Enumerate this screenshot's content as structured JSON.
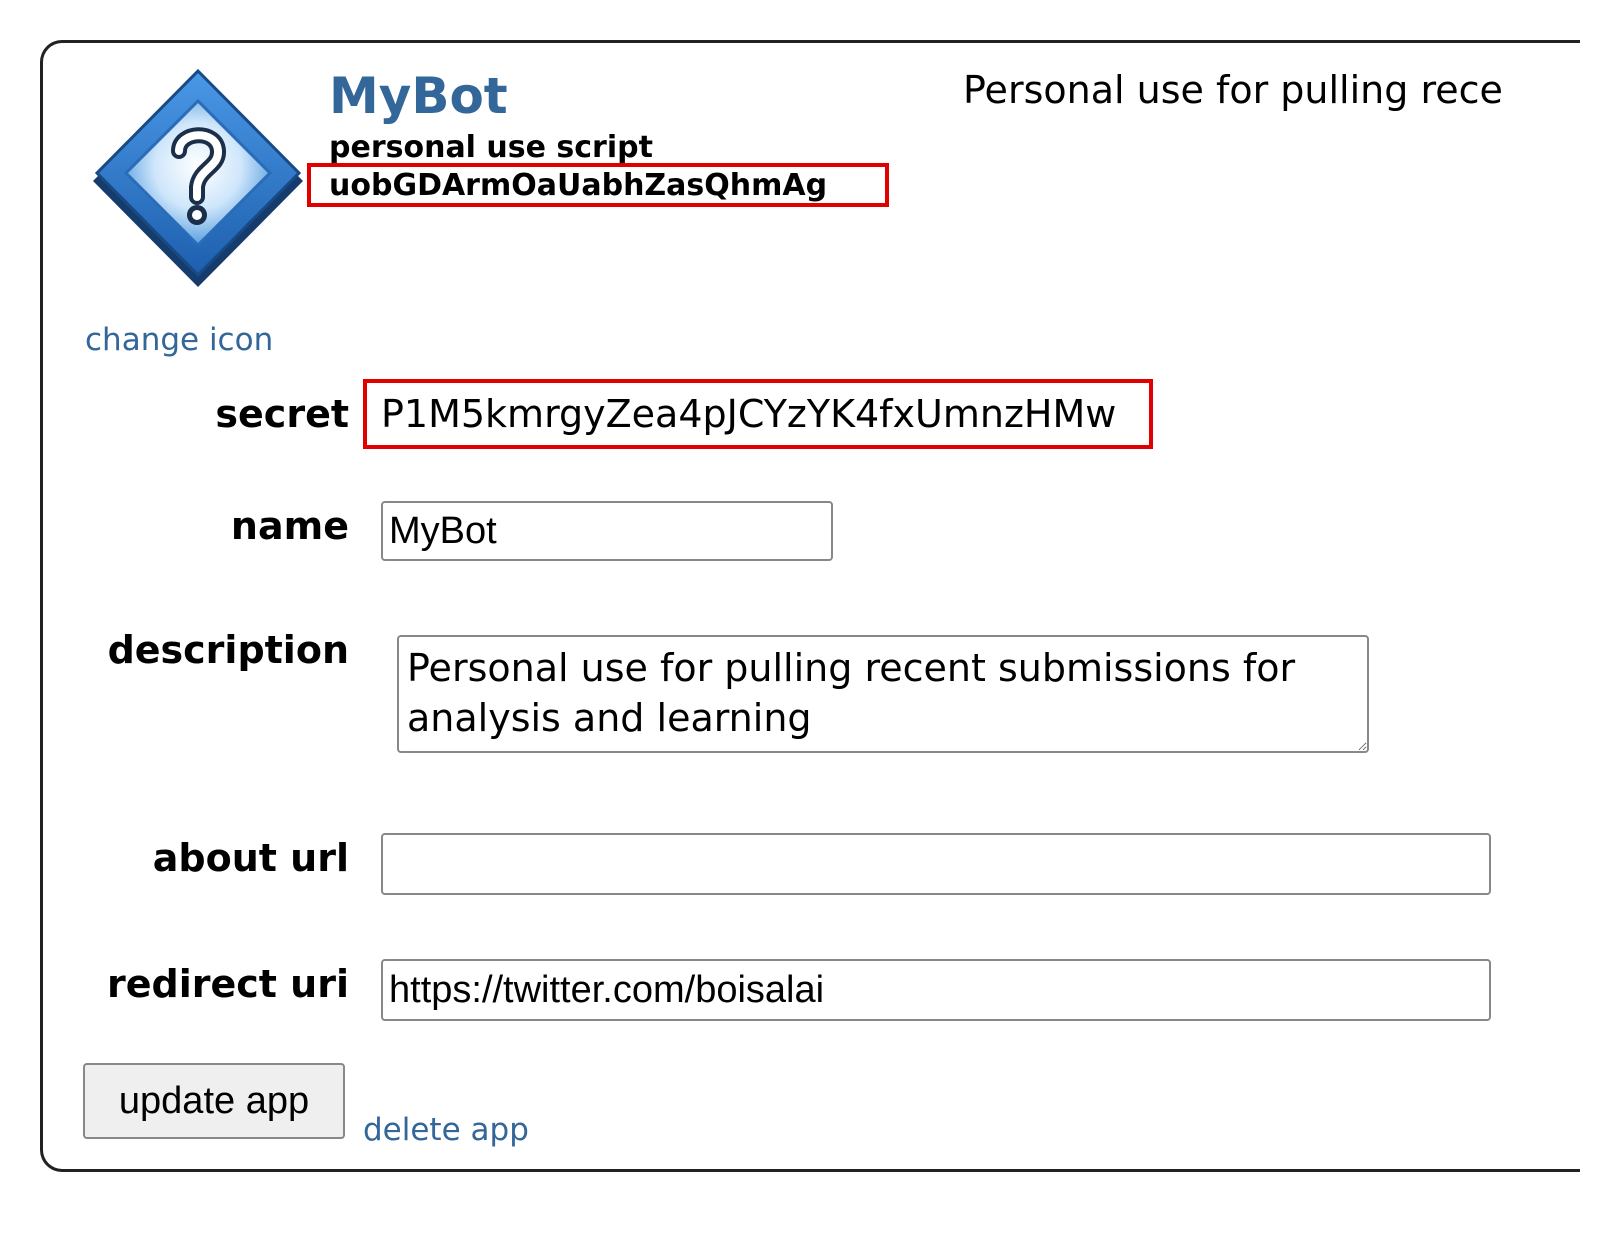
{
  "app": {
    "name": "MyBot",
    "type": "personal use script",
    "client_id": "uobGDArmOaUabhZasQhmAg",
    "description_preview": "Personal use for pulling rece",
    "change_icon_label": "change icon",
    "icon": "question-mark-diamond-icon"
  },
  "form": {
    "secret_label": "secret",
    "secret_value": "P1M5kmrgyZea4pJCYzYK4fxUmnzHMw",
    "name_label": "name",
    "name_value": "MyBot",
    "description_label": "description",
    "description_value": "Personal use for pulling recent submissions for analysis and learning",
    "about_url_label": "about url",
    "about_url_value": "",
    "redirect_uri_label": "redirect uri",
    "redirect_uri_value": "https://twitter.com/boisalai"
  },
  "actions": {
    "update_label": "update app",
    "delete_label": "delete app"
  },
  "colors": {
    "link": "#336699",
    "highlight": "#e00000",
    "icon_blue": "#2a78c8"
  }
}
